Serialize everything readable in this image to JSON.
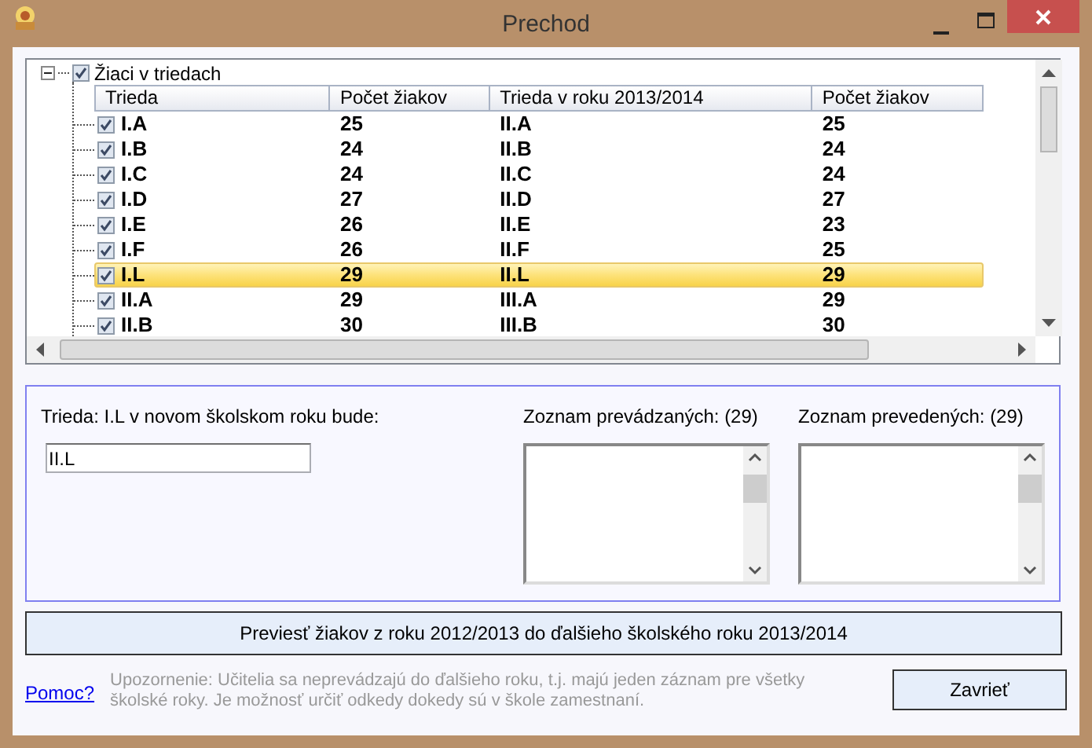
{
  "window": {
    "title": "Prechod"
  },
  "tree": {
    "root": {
      "label": "Žiaci v triedach",
      "checked": true,
      "expanded": true
    },
    "columns": [
      "Trieda",
      "Počet žiakov",
      "Trieda v roku 2013/2014",
      "Počet žiakov"
    ],
    "rows": [
      {
        "checked": true,
        "selected": false,
        "cells": [
          "I.A",
          "25",
          "II.A",
          "25"
        ]
      },
      {
        "checked": true,
        "selected": false,
        "cells": [
          "I.B",
          "24",
          "II.B",
          "24"
        ]
      },
      {
        "checked": true,
        "selected": false,
        "cells": [
          "I.C",
          "24",
          "II.C",
          "24"
        ]
      },
      {
        "checked": true,
        "selected": false,
        "cells": [
          "I.D",
          "27",
          "II.D",
          "27"
        ]
      },
      {
        "checked": true,
        "selected": false,
        "cells": [
          "I.E",
          "26",
          "II.E",
          "23"
        ]
      },
      {
        "checked": true,
        "selected": false,
        "cells": [
          "I.F",
          "26",
          "II.F",
          "25"
        ]
      },
      {
        "checked": true,
        "selected": true,
        "cells": [
          "I.L",
          "29",
          "II.L",
          "29"
        ]
      },
      {
        "checked": true,
        "selected": false,
        "cells": [
          "II.A",
          "29",
          "III.A",
          "29"
        ]
      },
      {
        "checked": true,
        "selected": false,
        "cells": [
          "II.B",
          "30",
          "III.B",
          "30"
        ]
      }
    ]
  },
  "detail": {
    "label": "Trieda: I.L v novom školskom roku bude:",
    "value": "II.L",
    "lists": [
      {
        "label": "Zoznam prevádzaných: (29)"
      },
      {
        "label": "Zoznam prevedených: (29)"
      }
    ]
  },
  "transfer_button": "Previesť žiakov z roku 2012/2013 do ďalšieho školského roku 2013/2014",
  "help_link": "Pomoc?",
  "note": "Upozornenie: Učitelia sa neprevádzajú do ďalšieho roku, t.j. majú jeden záznam pre všetky školské roky. Je možnosť určiť odkedy dokedy sú v škole zamestnaní.",
  "close_button": "Zavrieť"
}
